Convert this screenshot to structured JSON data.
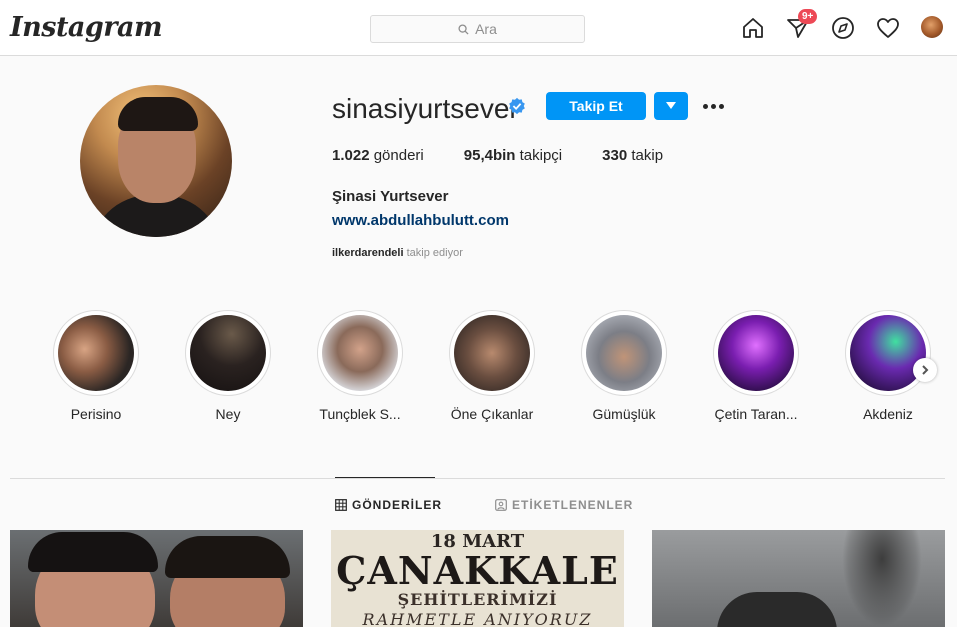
{
  "topbar": {
    "logo": "Instagram",
    "search_placeholder": "Ara",
    "notification_badge": "9+"
  },
  "profile": {
    "username": "sinasiyurtsever",
    "verified": true,
    "follow_label": "Takip Et",
    "stats": [
      {
        "value": "1.022",
        "label": "gönderi"
      },
      {
        "value": "95,4bin",
        "label": "takipçi"
      },
      {
        "value": "330",
        "label": "takip"
      }
    ],
    "full_name": "Şinasi Yurtsever",
    "website": "www.abdullahbulutt.com",
    "followed_by_user": "ilkerdarendeli",
    "followed_by_text": "takip ediyor"
  },
  "highlights": [
    {
      "label": "Perisino"
    },
    {
      "label": "Ney"
    },
    {
      "label": "Tunçblek S..."
    },
    {
      "label": "Öne Çıkanlar"
    },
    {
      "label": "Gümüşlük"
    },
    {
      "label": "Çetin Taran..."
    },
    {
      "label": "Akdeniz"
    }
  ],
  "tabs": {
    "posts": "GÖNDERİLER",
    "tagged": "ETİKETLENENLER"
  },
  "posts": [
    {
      "caption_lines": []
    },
    {
      "caption_lines": [
        "18 MART",
        "ÇANAKKALE",
        "ŞEHİTLERİMİZİ",
        "RAHMETLE ANIYORUZ"
      ]
    },
    {
      "caption_lines": []
    }
  ],
  "colors": {
    "accent": "#0095f6",
    "badge": "#ed4956",
    "link": "#00376b"
  }
}
